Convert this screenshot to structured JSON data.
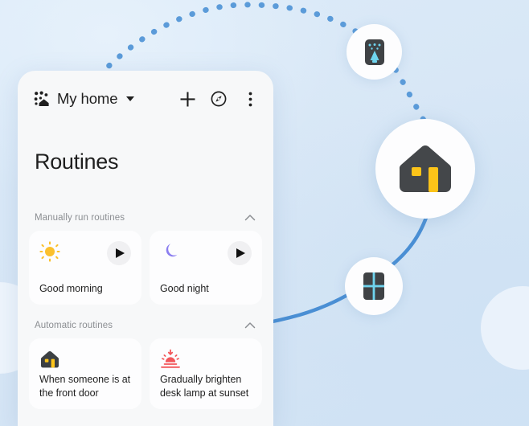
{
  "app": {
    "home_label": "My home",
    "page_title": "Routines",
    "home_icon": "home-cluster-icon",
    "dropdown_icon": "chevron-down-icon",
    "actions": [
      {
        "name": "add-button",
        "icon": "plus-icon",
        "label": "Add"
      },
      {
        "name": "explore-button",
        "icon": "compass-icon",
        "label": "Explore"
      },
      {
        "name": "overflow-button",
        "icon": "more-vertical-icon",
        "label": "More options"
      }
    ]
  },
  "sections": [
    {
      "id": "manual",
      "label": "Manually run routines",
      "chevron_icon": "chevron-up-icon",
      "expanded": true,
      "routines": [
        {
          "name": "Good morning",
          "icon": "sun-icon",
          "icon_color": "#fbc02d",
          "has_play": true,
          "play_icon": "play-icon"
        },
        {
          "name": "Good night",
          "icon": "moon-icon",
          "icon_color": "#8b7ef0",
          "has_play": true,
          "play_icon": "play-icon"
        }
      ]
    },
    {
      "id": "automatic",
      "label": "Automatic routines",
      "chevron_icon": "chevron-up-icon",
      "expanded": true,
      "routines": [
        {
          "name": "When someone is at the front door",
          "icon": "house-doorbell-icon",
          "icon_color": "#3c4043",
          "has_play": false,
          "play_icon": ""
        },
        {
          "name": "Gradually brighten desk lamp at sunset",
          "icon": "sunset-icon",
          "icon_color": "#f2565a",
          "has_play": false,
          "play_icon": ""
        }
      ]
    }
  ],
  "scene": {
    "nodes": [
      {
        "name": "device-node-air-purifier",
        "icon": "air-purifier-icon"
      },
      {
        "name": "home-node",
        "icon": "house-icon"
      },
      {
        "name": "device-node-window",
        "icon": "window-icon"
      }
    ],
    "colors": {
      "background": "#dbe9f7",
      "connector_solid": "#4a8fd4",
      "connector_dotted": "#5b9bd9",
      "house_body": "#44474a",
      "house_accent": "#fcc419",
      "device_body": "#3f4245",
      "device_accent": "#6fd4ee"
    }
  }
}
